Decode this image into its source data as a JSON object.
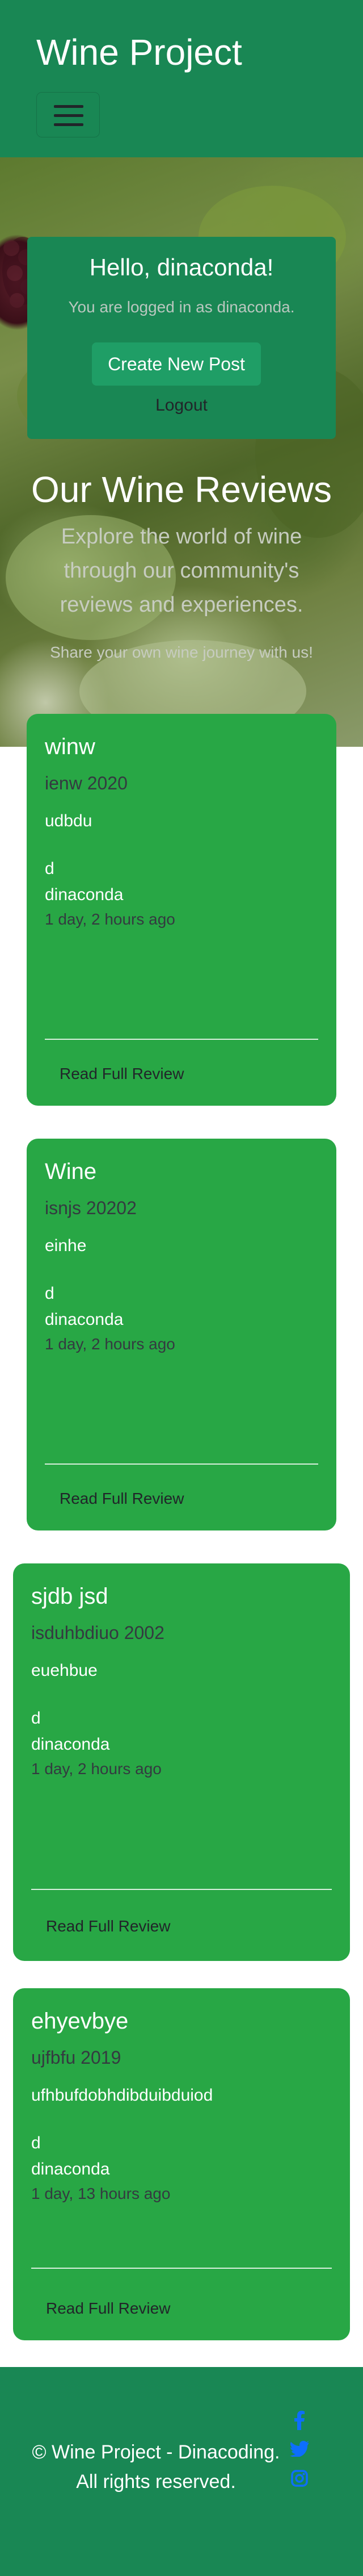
{
  "navbar": {
    "brand": "Wine Project",
    "toggle_icon": "hamburger-menu-icon"
  },
  "welcome": {
    "title": "Hello, dinaconda!",
    "subtitle": "You are logged in as dinaconda.",
    "create_button": "Create New Post",
    "logout": "Logout"
  },
  "hero": {
    "title": "Our Wine Reviews",
    "text": "Explore the world of wine through our community's reviews and experiences.",
    "text2": "Share your own wine journey with us!"
  },
  "posts": [
    {
      "title": "winw",
      "subtitle": "ienw 2020",
      "text": "udbdu",
      "d": "d",
      "author": "dinaconda",
      "time": "1 day, 2 hours ago",
      "link": "Read Full Review"
    },
    {
      "title": "Wine",
      "subtitle": "isnjs 20202",
      "text": "einhe",
      "d": "d",
      "author": "dinaconda",
      "time": "1 day, 2 hours ago",
      "link": "Read Full Review"
    },
    {
      "title": "sjdb jsd",
      "subtitle": "isduhbdiuo 2002",
      "text": "euehbue",
      "d": "d",
      "author": "dinaconda",
      "time": "1 day, 2 hours ago",
      "link": "Read Full Review"
    },
    {
      "title": "ehyevbye",
      "subtitle": "ujfbfu 2019",
      "text": "ufhbufdobhdibduibduiod",
      "d": "d",
      "author": "dinaconda",
      "time": "1 day, 13 hours ago",
      "link": "Read Full Review"
    }
  ],
  "footer": {
    "line1": "© Wine Project - Dinacoding.",
    "line2": "All rights reserved.",
    "social_icons": [
      "facebook-icon",
      "twitter-icon",
      "instagram-icon"
    ]
  },
  "colors": {
    "header_bg": "#198754",
    "card_bg": "#28a745",
    "social_icon": "#0d6efd"
  }
}
